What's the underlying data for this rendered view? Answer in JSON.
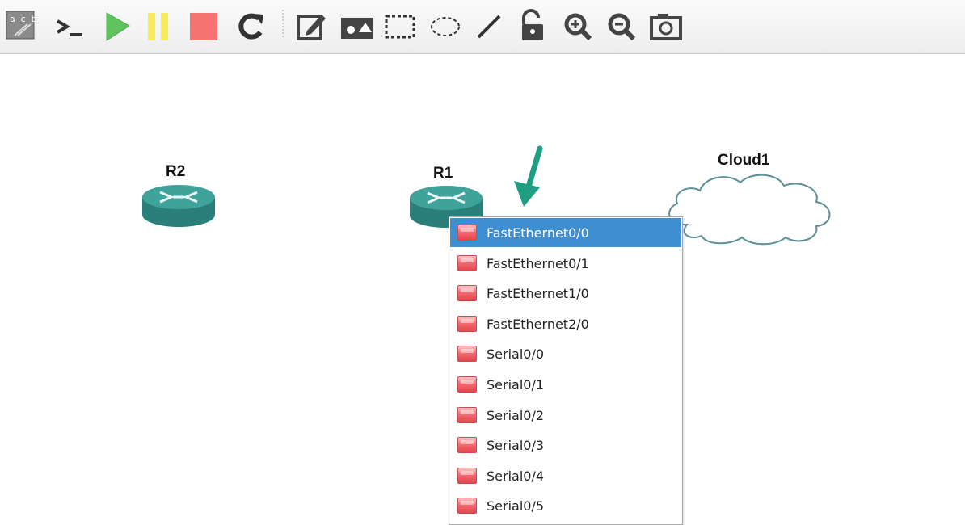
{
  "toolbar": {
    "buttons": [
      {
        "name": "show-labels-icon",
        "label": "a c b"
      },
      {
        "name": "console-icon",
        "label": ">_"
      },
      {
        "name": "start-icon"
      },
      {
        "name": "suspend-icon"
      },
      {
        "name": "stop-icon"
      },
      {
        "name": "reload-icon"
      },
      {
        "name": "add-note-icon"
      },
      {
        "name": "insert-image-icon"
      },
      {
        "name": "draw-rectangle-icon"
      },
      {
        "name": "draw-ellipse-icon"
      },
      {
        "name": "draw-line-icon"
      },
      {
        "name": "lock-icon"
      },
      {
        "name": "zoom-in-icon"
      },
      {
        "name": "zoom-out-icon"
      },
      {
        "name": "screenshot-icon"
      }
    ]
  },
  "topology": {
    "nodes": [
      {
        "id": "r2",
        "label": "R2",
        "type": "router"
      },
      {
        "id": "r1",
        "label": "R1",
        "type": "router"
      },
      {
        "id": "cloud1",
        "label": "Cloud1",
        "type": "cloud"
      }
    ]
  },
  "interface_menu": {
    "selected_index": 0,
    "items": [
      "FastEthernet0/0",
      "FastEthernet0/1",
      "FastEthernet1/0",
      "FastEthernet2/0",
      "Serial0/0",
      "Serial0/1",
      "Serial0/2",
      "Serial0/3",
      "Serial0/4",
      "Serial0/5"
    ]
  },
  "colors": {
    "router_fill": "#2e8b85",
    "selection": "#3d8fd1",
    "arrow": "#1f9e83",
    "port_icon": "#f56a70"
  }
}
